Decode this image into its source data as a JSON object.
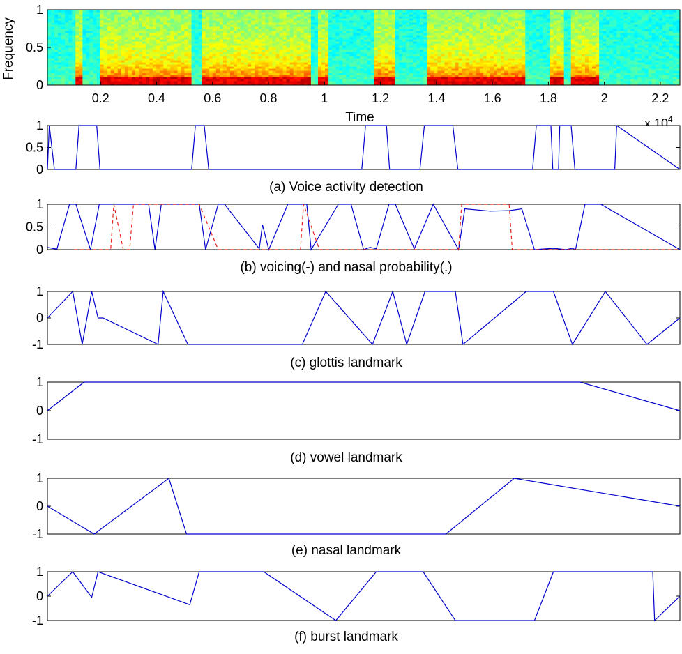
{
  "colors": {
    "voicing": "#0000cc",
    "nasal": "#e8201a",
    "axis": "#000000"
  },
  "chart_data": [
    {
      "type": "heatmap",
      "ylabel": "Frequency",
      "xlabel": "Time",
      "x_multiplier": "x 10",
      "x_multiplier_exponent": "4",
      "xlim": [
        0.01,
        2.27
      ],
      "ylim": [
        0,
        1
      ],
      "xticks": [
        0.2,
        0.4,
        0.6,
        0.8,
        1,
        1.2,
        1.4,
        1.6,
        1.8,
        2,
        2.2
      ],
      "xtick_labels": [
        "0.2",
        "0.4",
        "0.6",
        "0.8",
        "1",
        "1.2",
        "1.4",
        "1.6",
        "1.8",
        "2",
        "2.2"
      ],
      "yticks": [
        0,
        0.5,
        1
      ],
      "ytick_labels": [
        "0",
        "0.5",
        "1"
      ],
      "colormap": "jet",
      "voiced_segments": [
        [
          0.11,
          0.14
        ],
        [
          0.2,
          0.52
        ],
        [
          0.56,
          0.95
        ],
        [
          0.98,
          1.02
        ],
        [
          1.18,
          1.25
        ],
        [
          1.36,
          1.45
        ],
        [
          1.45,
          1.72
        ],
        [
          1.81,
          1.85
        ],
        [
          1.88,
          1.98
        ]
      ]
    },
    {
      "type": "line",
      "caption": "(a) Voice activity detection",
      "xlim": [
        0,
        1
      ],
      "ylim": [
        0,
        1
      ],
      "yticks": [
        0,
        0.5,
        1
      ],
      "ytick_labels": [
        "0",
        "0.5",
        "1"
      ],
      "series": [
        {
          "style": "solid",
          "x": [
            0,
            0.003,
            0.011,
            0.045,
            0.05,
            0.078,
            0.083,
            0.228,
            0.234,
            0.248,
            0.255,
            0.497,
            0.503,
            0.536,
            0.541,
            0.589,
            0.596,
            0.641,
            0.649,
            0.767,
            0.773,
            0.796,
            0.799,
            0.808,
            0.81,
            0.828,
            0.834,
            0.897,
            0.9,
            1
          ],
          "y": [
            0,
            1,
            0,
            0,
            1,
            1,
            0,
            0,
            1,
            1,
            0,
            0,
            1,
            1,
            0,
            0,
            1,
            1,
            0,
            0,
            1,
            1,
            0,
            0,
            1,
            1,
            0,
            0,
            1,
            0
          ]
        }
      ]
    },
    {
      "type": "line",
      "caption": "(b) voicing(-) and nasal probability(.)",
      "xlim": [
        0,
        1
      ],
      "ylim": [
        0,
        1
      ],
      "yticks": [
        0,
        0.5,
        1
      ],
      "ytick_labels": [
        "0",
        "0.5",
        "1"
      ],
      "series": [
        {
          "style": "solid",
          "x": [
            0,
            0.015,
            0.035,
            0.045,
            0.068,
            0.082,
            0.09,
            0.16,
            0.17,
            0.18,
            0.19,
            0.24,
            0.25,
            0.27,
            0.28,
            0.335,
            0.34,
            0.35,
            0.38,
            0.41,
            0.417,
            0.46,
            0.48,
            0.5,
            0.51,
            0.52,
            0.54,
            0.55,
            0.58,
            0.61,
            0.61,
            0.65,
            0.66,
            0.7,
            0.73,
            0.75,
            0.77,
            0.8,
            0.82,
            0.83,
            0.835,
            0.85,
            0.875,
            1
          ],
          "y": [
            0.05,
            0.01,
            1,
            1,
            0,
            1,
            1,
            1,
            0,
            1,
            1,
            1,
            0,
            1,
            1,
            0.02,
            0.55,
            0,
            1,
            1,
            0,
            1,
            1,
            0,
            0.05,
            0.02,
            1,
            1,
            0.02,
            1,
            1,
            0,
            0.9,
            0.85,
            0.86,
            0.9,
            0,
            0.03,
            0,
            0.03,
            0,
            1,
            1,
            0
          ]
        },
        {
          "style": "dashed",
          "x": [
            0.042,
            0.1,
            0.105,
            0.12,
            0.13,
            0.136,
            0.138,
            0.16,
            0.2,
            0.22,
            0.24,
            0.27,
            0.3,
            0.32,
            0.4,
            0.405,
            0.43,
            0.445,
            0.5,
            0.6,
            0.65,
            0.655,
            0.73,
            0.735,
            0.8,
            0.92,
            1
          ],
          "y": [
            0,
            0,
            1,
            0,
            0,
            1,
            1,
            1,
            1,
            1,
            1,
            0,
            0,
            0,
            0,
            1,
            0,
            0,
            0,
            0,
            0,
            1,
            1,
            0,
            0,
            0,
            0
          ]
        }
      ]
    },
    {
      "type": "line",
      "caption": "(c) glottis landmark",
      "xlim": [
        0,
        1
      ],
      "ylim": [
        -1,
        1
      ],
      "yticks": [
        -1,
        0,
        1
      ],
      "ytick_labels": [
        "-1",
        "0",
        "1"
      ],
      "series": [
        {
          "style": "solid",
          "x": [
            0,
            0.04,
            0.055,
            0.07,
            0.08,
            0.088,
            0.175,
            0.183,
            0.222,
            0.403,
            0.44,
            0.514,
            0.546,
            0.568,
            0.597,
            0.645,
            0.657,
            0.757,
            0.8,
            0.83,
            0.882,
            0.948,
            1
          ],
          "y": [
            0,
            1,
            -1,
            1,
            0,
            0,
            -1,
            1,
            -1,
            -1,
            1,
            -1,
            1,
            -1,
            1,
            1,
            -1,
            1,
            1,
            -1,
            1,
            -1,
            0
          ]
        }
      ]
    },
    {
      "type": "line",
      "caption": "(d) vowel landmark",
      "xlim": [
        0,
        1
      ],
      "ylim": [
        -1,
        1
      ],
      "yticks": [
        -1,
        0,
        1
      ],
      "ytick_labels": [
        "-1",
        "0",
        "1"
      ],
      "series": [
        {
          "style": "solid",
          "x": [
            0,
            0.058,
            0.09,
            0.195,
            0.286,
            0.385,
            0.472,
            0.538,
            0.616,
            0.656,
            0.74,
            0.842,
            1
          ],
          "y": [
            0,
            1,
            1,
            1,
            1,
            1,
            1,
            1,
            1,
            1,
            1,
            1,
            0
          ]
        }
      ]
    },
    {
      "type": "line",
      "caption": "(e) nasal landmark",
      "xlim": [
        0,
        1
      ],
      "ylim": [
        -1,
        1
      ],
      "yticks": [
        -1,
        0,
        1
      ],
      "ytick_labels": [
        "-1",
        "0",
        "1"
      ],
      "series": [
        {
          "style": "solid",
          "x": [
            0,
            0.074,
            0.192,
            0.22,
            0.405,
            0.49,
            0.55,
            0.63,
            0.738,
            1
          ],
          "y": [
            0,
            -1,
            1,
            -1,
            -1,
            -1,
            -1,
            -1,
            1,
            0
          ]
        }
      ]
    },
    {
      "type": "line",
      "caption": "(f) burst landmark",
      "xlim": [
        0,
        1
      ],
      "ylim": [
        -1,
        1
      ],
      "yticks": [
        -1,
        0,
        1
      ],
      "ytick_labels": [
        "-1",
        "0",
        "1"
      ],
      "series": [
        {
          "style": "solid",
          "x": [
            0,
            0.04,
            0.07,
            0.08,
            0.225,
            0.24,
            0.342,
            0.456,
            0.52,
            0.594,
            0.645,
            0.77,
            0.8,
            0.957,
            0.96,
            1
          ],
          "y": [
            0,
            1,
            -0.05,
            1,
            -0.35,
            1,
            1,
            -1,
            1,
            1,
            -1,
            -1,
            1,
            1,
            -1,
            0
          ]
        }
      ]
    }
  ]
}
